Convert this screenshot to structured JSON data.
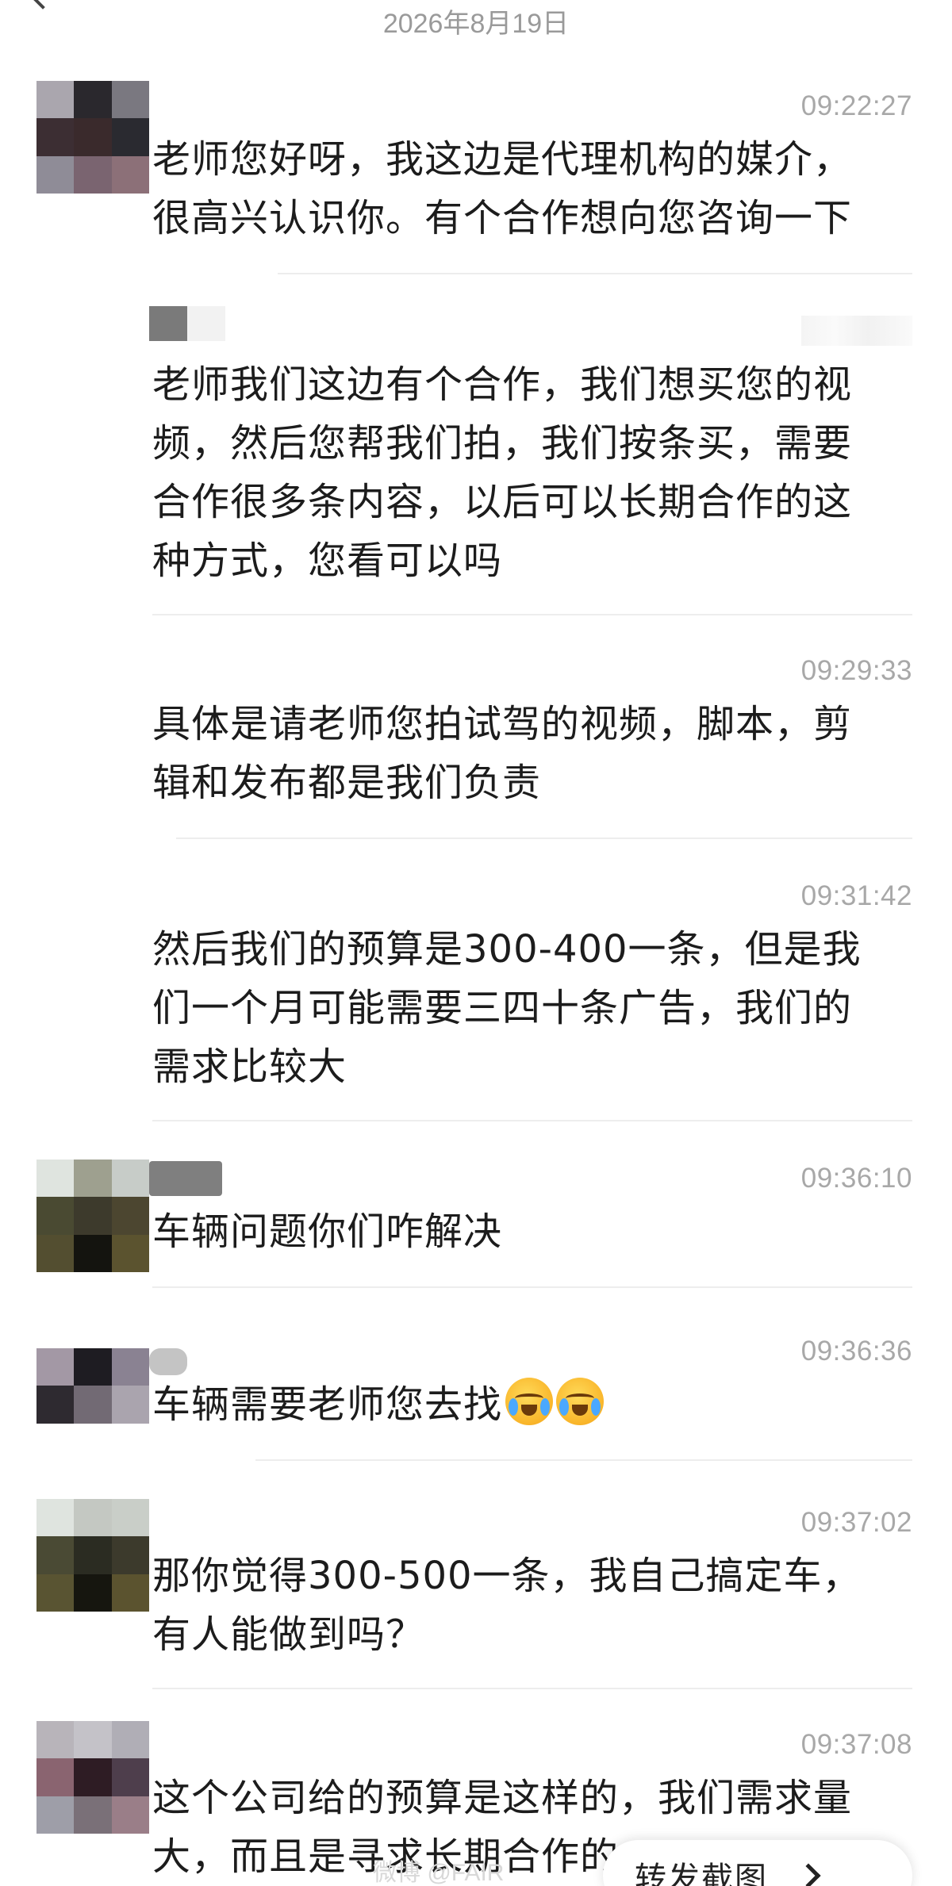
{
  "header": {
    "date": "2026年8月19日"
  },
  "messages": [
    {
      "time": "09:22:27",
      "text": [
        "老师您好呀，我这边是代理机构的媒介，",
        "很高兴认识你。有个合作想向您咨询一下"
      ]
    },
    {
      "time": "",
      "text": [
        "老师我们这边有个合作，我们想买您的视",
        "频，然后您帮我们拍，我们按条买，需要",
        "合作很多条内容，以后可以长期合作的这",
        "种方式，您看可以吗"
      ]
    },
    {
      "time": "09:29:33",
      "text": [
        "具体是请老师您拍试驾的视频，脚本，剪",
        "辑和发布都是我们负责"
      ]
    },
    {
      "time": "09:31:42",
      "text": [
        "然后我们的预算是300-400一条，但是我",
        "们一个月可能需要三四十条广告，我们的",
        "需求比较大"
      ]
    },
    {
      "time": "09:36:10",
      "text": [
        "车辆问题你们咋解决"
      ]
    },
    {
      "time": "09:36:36",
      "text": [
        "车辆需要老师您去找"
      ]
    },
    {
      "time": "09:37:02",
      "text": [
        "那你觉得300-500一条，我自己搞定车，",
        "有人能做到吗？"
      ]
    },
    {
      "time": "09:37:08",
      "text": [
        "这个公司给的预算是这样的，我们需求量",
        "大，而且是寻求长期合作的"
      ]
    }
  ],
  "emojis": [
    "crying-laughing-emoji",
    "crying-laughing-emoji"
  ],
  "footer": {
    "forward_label": "转发截图",
    "watermark": "微博 @FAIR"
  },
  "colors": {
    "text": "#1c1c1c",
    "time": "#a8a8a8",
    "date": "#9a9a9a",
    "divider": "#ededed"
  }
}
